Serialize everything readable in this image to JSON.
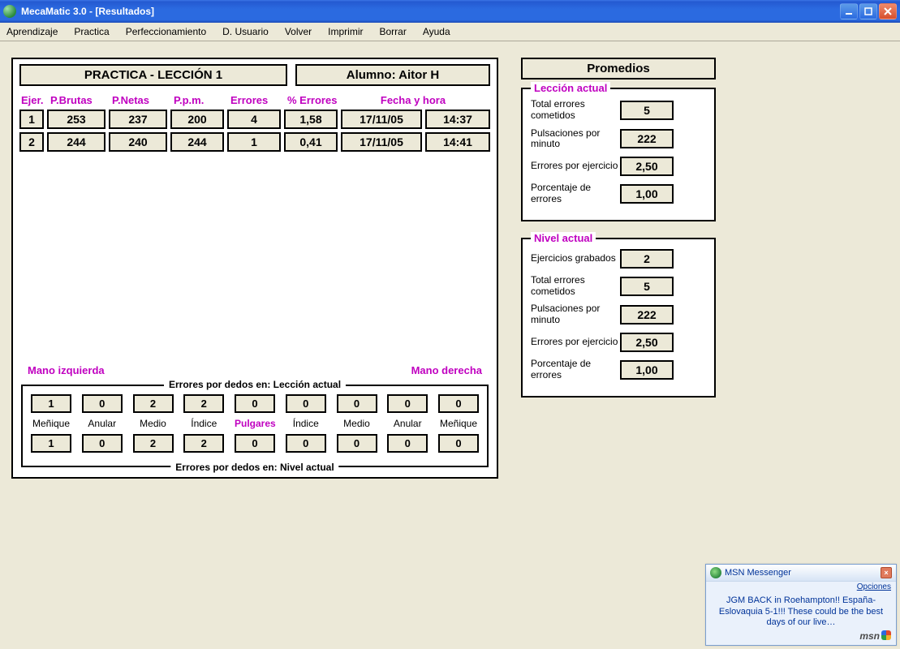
{
  "window": {
    "title": "MecaMatic 3.0  - [Resultados]"
  },
  "menu": [
    "Aprendizaje",
    "Practica",
    "Perfeccionamiento",
    "D. Usuario",
    "Volver",
    "Imprimir",
    "Borrar",
    "Ayuda"
  ],
  "header": {
    "lesson": "PRACTICA  -  LECCIÓN  1",
    "student": "Alumno:  Aitor H"
  },
  "columns": {
    "ejer": "Ejer.",
    "pbrutas": "P.Brutas",
    "pnetas": "P.Netas",
    "ppm": "P.p.m.",
    "errores": "Errores",
    "pct": "% Errores",
    "fecha": "Fecha   y   hora"
  },
  "results": [
    {
      "n": "1",
      "pb": "253",
      "pn": "237",
      "ppm": "200",
      "err": "4",
      "pct": "1,58",
      "date": "17/11/05",
      "time": "14:37"
    },
    {
      "n": "2",
      "pb": "244",
      "pn": "240",
      "ppm": "244",
      "err": "1",
      "pct": "0,41",
      "date": "17/11/05",
      "time": "14:41"
    }
  ],
  "hands": {
    "left": "Mano izquierda",
    "right": "Mano derecha"
  },
  "fingers": {
    "title_top": "Errores por dedos en: Lección actual",
    "title_bottom": "Errores por dedos en:  Nivel actual",
    "labels": [
      "Meñique",
      "Anular",
      "Medio",
      "Índice",
      "Pulgares",
      "Índice",
      "Medio",
      "Anular",
      "Meñique"
    ],
    "lesson_vals": [
      "1",
      "0",
      "2",
      "2",
      "0",
      "0",
      "0",
      "0",
      "0"
    ],
    "level_vals": [
      "1",
      "0",
      "2",
      "2",
      "0",
      "0",
      "0",
      "0",
      "0"
    ]
  },
  "averages": {
    "title": "Promedios",
    "lesson": {
      "legend": "Lección actual",
      "items": [
        {
          "label": "Total errores cometidos",
          "value": "5"
        },
        {
          "label": "Pulsaciones por minuto",
          "value": "222"
        },
        {
          "label": "Errores por ejercicio",
          "value": "2,50"
        },
        {
          "label": "Porcentaje de errores",
          "value": "1,00"
        }
      ]
    },
    "level": {
      "legend": "Nivel actual",
      "items": [
        {
          "label": "Ejercicios grabados",
          "value": "2"
        },
        {
          "label": "Total errores cometidos",
          "value": "5"
        },
        {
          "label": "Pulsaciones por minuto",
          "value": "222"
        },
        {
          "label": "Errores por ejercicio",
          "value": "2,50"
        },
        {
          "label": "Porcentaje de errores",
          "value": "1,00"
        }
      ]
    }
  },
  "msn": {
    "title": "MSN Messenger",
    "options": "Opciones",
    "body": "JGM BACK in Roehampton!! España-Eslovaquia 5-1!!! These could be the best days of our live…",
    "brand": "msn"
  }
}
